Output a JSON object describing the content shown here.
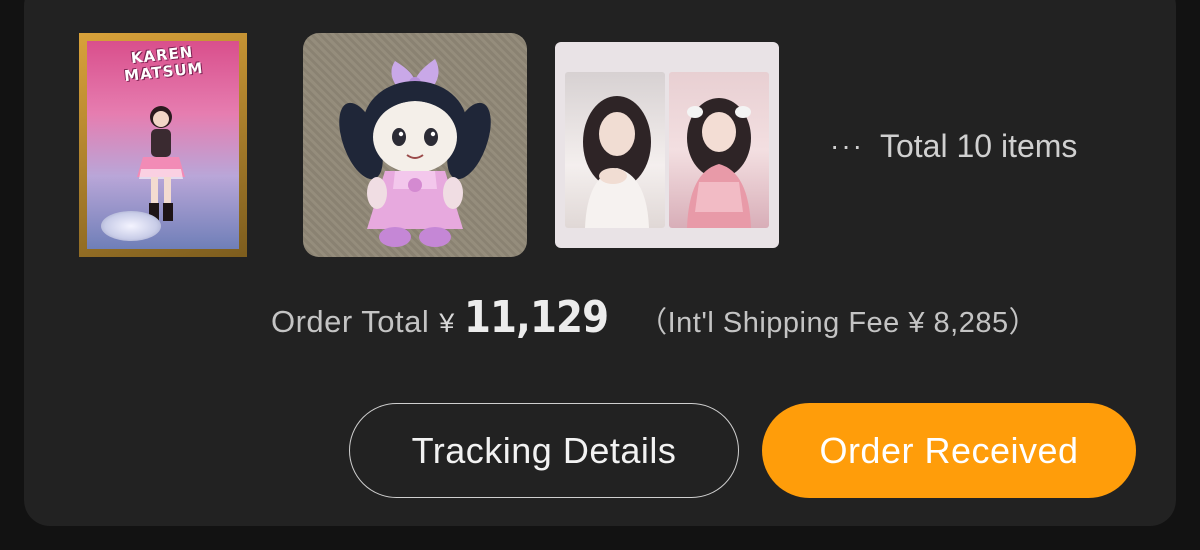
{
  "items": [
    {
      "name": "acrylic-stand",
      "label_text": "KAREN MATSUM"
    },
    {
      "name": "plush-doll"
    },
    {
      "name": "photo-set"
    }
  ],
  "more": {
    "dots": "···",
    "text": "Total 10 items"
  },
  "order": {
    "total_label": "Order Total",
    "currency": "¥",
    "total_amount": "11,129",
    "shipping_note": "（Int'l Shipping Fee ¥ 8,285）"
  },
  "buttons": {
    "tracking_label": "Tracking Details",
    "received_label": "Order Received"
  },
  "colors": {
    "background": "#121212",
    "card": "#222222",
    "accent": "#ff9d0a"
  }
}
